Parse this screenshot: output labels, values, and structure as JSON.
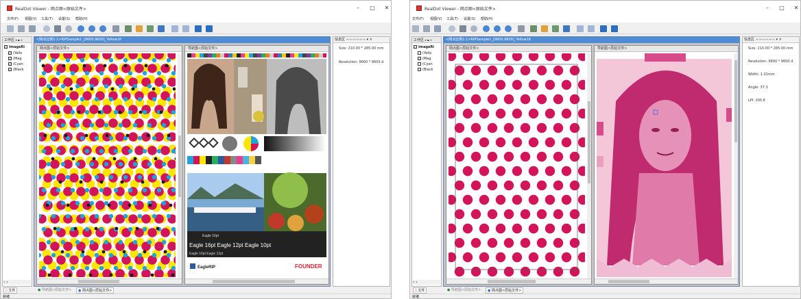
{
  "left": {
    "window_title": "RealDot Viewer - 网点图<原始文件>",
    "menu": [
      "文件(F)",
      "视图(V)",
      "工具(T)",
      "设置(S)",
      "帮助(H)"
    ],
    "left_panel_title": "工作区",
    "tree_root": "ImageRi",
    "tree_items": [
      {
        "label": "(Yello",
        "checked": true
      },
      {
        "label": "(Mag",
        "checked": true
      },
      {
        "label": "(Cyan",
        "checked": true
      },
      {
        "label": "(Black",
        "checked": true
      }
    ],
    "doc_title": "<网点比例1:1>RIPSample1_[9600,9600]_Yellow.tif",
    "view_left_title": "网点图<原始文件>",
    "view_right_title": "导航图<原始文件>",
    "info_title": "信息区",
    "info_lines": [
      "Size: 210.00 * 285.00 mm",
      "Resolution: 9600 * 9600 d"
    ],
    "bottom_tab_left": "文件",
    "bottom_tabs": [
      "导航图<原始文件>",
      "网点图<原始文件>"
    ],
    "status": "就绪",
    "proof": {
      "top_text": "Eagle 16pt",
      "mid_text": "Eagle 16pt Eagle 12pt Eagle 10pt",
      "bottom_text": "Eagle 16pt Eagle 12pt",
      "logo_left": "EagleRIP",
      "logo_right": "FOUNDER"
    }
  },
  "right": {
    "window_title": "RealDot Viewer - 网点图<原始文件>",
    "menu": [
      "文件(F)",
      "视图(V)",
      "工具(T)",
      "设置(S)",
      "帮助(H)"
    ],
    "left_panel_title": "工作区",
    "tree_root": "ImageRi",
    "tree_items": [
      {
        "label": "(Yello",
        "checked": false
      },
      {
        "label": "(Mag",
        "checked": true
      },
      {
        "label": "(Cyan",
        "checked": false
      },
      {
        "label": "(Black",
        "checked": false
      }
    ],
    "doc_title": "<网点比例1:1>RIPSample1_[9600,9600]_Yellow.tif",
    "view_left_title": "网点图<原始文件>",
    "view_right_title": "导航图<原始文件>",
    "info_title": "信息区",
    "info_lines": [
      "Size: 210.00 * 285.00 mm",
      "Resolution: 9600 * 9600 d",
      "Width: 1.01mm",
      "Angle: 37.3",
      "LPI: 200.8"
    ],
    "bottom_tab_left": "文件",
    "bottom_tabs": [
      "导航图<原始文件>",
      "网点图<原始文件>"
    ],
    "status": "就绪"
  },
  "colors": {
    "yellow": "#ffe600",
    "magenta": "#d4145a",
    "cyan": "#1fa3dc",
    "black": "#1c1c1c",
    "accent": "#4f8cd6",
    "pink": "#d74a8b"
  }
}
